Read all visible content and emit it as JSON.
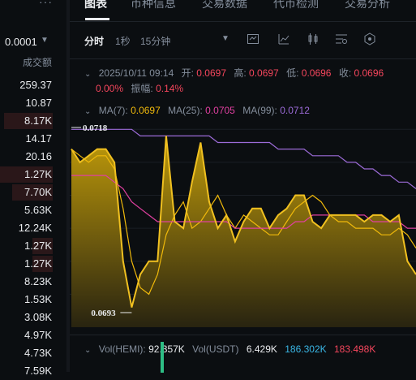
{
  "orderbook": {
    "menu_icon": "more-dots-icon",
    "price_step": "0.0001",
    "volume_header": "成交额",
    "volumes": [
      "259.37",
      "10.87",
      "8.17K",
      "14.17",
      "20.16",
      "1.27K",
      "7.70K",
      "5.63K",
      "12.24K",
      "1.27K",
      "1.27K",
      "8.23K",
      "1.53K",
      "3.08K",
      "4.97K",
      "4.73K",
      "7.59K"
    ],
    "colors": {
      "sell_bg": "#2a1719",
      "text": "#eaecef",
      "muted": "#848e9c"
    }
  },
  "tabs": [
    "图表",
    "币种信息",
    "交易数据",
    "代币检测",
    "交易分析"
  ],
  "timeframes": [
    "分时",
    "1秒",
    "15分钟"
  ],
  "toolbar_icons": [
    "dropdown-caret-icon",
    "indicator-icon",
    "chart-type-icon",
    "candle-icon",
    "settings-icon",
    "hexagon-icon"
  ],
  "info": {
    "date": "2025/10/11 09:14",
    "open_label": "开:",
    "open": "0.0697",
    "high_label": "高:",
    "high": "0.0697",
    "low_label": "低:",
    "low": "0.0696",
    "close_label": "收:",
    "close": "0.0696",
    "change": "0.00%",
    "amp_label": "振幅:",
    "amp": "0.14%"
  },
  "ma": {
    "ma7_label": "MA(7):",
    "ma7": "0.0697",
    "ma25_label": "MA(25):",
    "ma25": "0.0705",
    "ma99_label": "MA(99):",
    "ma99": "0.0712",
    "colors": {
      "ma7": "#f0b90b",
      "ma25": "#e040a0",
      "ma99": "#9c6bd8"
    }
  },
  "chart_data": {
    "type": "area",
    "series": [
      {
        "name": "MA(7)",
        "values": [
          0.0717,
          0.0716,
          0.0715,
          0.0716,
          0.0716,
          0.0714,
          0.0708,
          0.07,
          0.0696,
          0.0695,
          0.0698,
          0.0704,
          0.0707,
          0.0709,
          0.0705,
          0.0706,
          0.0708,
          0.071,
          0.0707,
          0.0705,
          0.0707,
          0.0706,
          0.0705,
          0.0704,
          0.0704,
          0.0706,
          0.0708,
          0.0709,
          0.071,
          0.0709,
          0.0707,
          0.0706,
          0.0706,
          0.0705,
          0.0705,
          0.0705,
          0.0704,
          0.0704,
          0.0705,
          0.0704,
          0.0702
        ]
      },
      {
        "name": "MA(25)",
        "values": [
          0.0713,
          0.0713,
          0.0713,
          0.0713,
          0.0713,
          0.0712,
          0.0711,
          0.0709,
          0.0708,
          0.0707,
          0.0706,
          0.0706,
          0.0706,
          0.0706,
          0.0706,
          0.0706,
          0.0706,
          0.0706,
          0.0706,
          0.0705,
          0.0705,
          0.0705,
          0.0705,
          0.0705,
          0.0705,
          0.0705,
          0.0706,
          0.0706,
          0.0707,
          0.0707,
          0.0707,
          0.0707,
          0.0707,
          0.0707,
          0.0707,
          0.0706,
          0.0706,
          0.0706,
          0.0706,
          0.0705,
          0.0705
        ]
      },
      {
        "name": "MA(99)",
        "values": [
          0.072,
          0.072,
          0.072,
          0.072,
          0.072,
          0.072,
          0.072,
          0.072,
          0.0719,
          0.0719,
          0.0719,
          0.0719,
          0.0719,
          0.0719,
          0.0719,
          0.0719,
          0.0719,
          0.0718,
          0.0718,
          0.0718,
          0.0718,
          0.0718,
          0.0718,
          0.0718,
          0.0717,
          0.0717,
          0.0717,
          0.0717,
          0.0716,
          0.0716,
          0.0716,
          0.0716,
          0.0715,
          0.0715,
          0.0714,
          0.0714,
          0.0713,
          0.0713,
          0.0712,
          0.0712,
          0.0711
        ]
      },
      {
        "name": "price",
        "values": [
          0.0717,
          0.0715,
          0.0716,
          0.0717,
          0.0717,
          0.0715,
          0.07,
          0.0693,
          0.0698,
          0.07,
          0.07,
          0.0719,
          0.0706,
          0.0705,
          0.0712,
          0.0718,
          0.0709,
          0.0705,
          0.0707,
          0.0703,
          0.0706,
          0.0708,
          0.0708,
          0.0705,
          0.0707,
          0.0708,
          0.071,
          0.071,
          0.0706,
          0.0705,
          0.0707,
          0.0707,
          0.0707,
          0.0707,
          0.0706,
          0.0707,
          0.0707,
          0.0706,
          0.0707,
          0.07,
          0.0698
        ]
      }
    ],
    "ylim": [
      0.069,
      0.0722
    ],
    "max_label": "0.0718",
    "min_label": "0.0693"
  },
  "volume": {
    "hemi_label": "Vol(HEMI):",
    "hemi": "92.357K",
    "usdt_label": "Vol(USDT)",
    "usdt": "6.429K",
    "v1": "186.302K",
    "v2": "183.498K",
    "colors": {
      "v1": "#3ab7e6",
      "v2": "#f6465d",
      "bar": "#2ebd85"
    }
  }
}
